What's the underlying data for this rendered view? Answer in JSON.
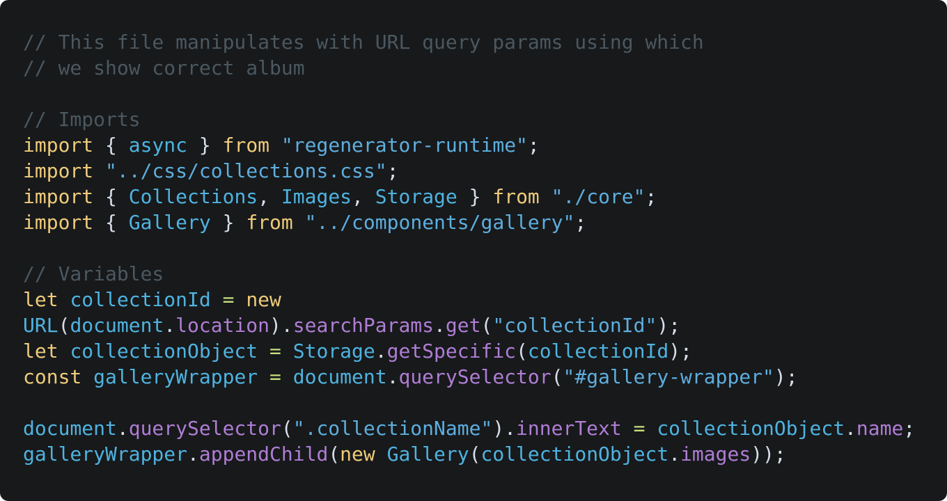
{
  "editor": {
    "background": "#17191b",
    "colors": {
      "comment": "#4b5860",
      "keyword": "#efcb7a",
      "identifier": "#4fb3e0",
      "string": "#5eaede",
      "property": "#b07dd4",
      "punctuation": "#d8dee9",
      "operator": "#c8df7c"
    },
    "lines": [
      [
        {
          "t": "comment",
          "v": "// This file manipulates with URL query params using which"
        }
      ],
      [
        {
          "t": "comment",
          "v": "// we show correct album"
        }
      ],
      [],
      [
        {
          "t": "comment",
          "v": "// Imports"
        }
      ],
      [
        {
          "t": "keyword",
          "v": "import"
        },
        {
          "t": "punct",
          "v": " { "
        },
        {
          "t": "ident",
          "v": "async"
        },
        {
          "t": "punct",
          "v": " } "
        },
        {
          "t": "keyword",
          "v": "from"
        },
        {
          "t": "punct",
          "v": " "
        },
        {
          "t": "string",
          "v": "\"regenerator-runtime\""
        },
        {
          "t": "punct",
          "v": ";"
        }
      ],
      [
        {
          "t": "keyword",
          "v": "import"
        },
        {
          "t": "punct",
          "v": " "
        },
        {
          "t": "string",
          "v": "\"../css/collections.css\""
        },
        {
          "t": "punct",
          "v": ";"
        }
      ],
      [
        {
          "t": "keyword",
          "v": "import"
        },
        {
          "t": "punct",
          "v": " { "
        },
        {
          "t": "ident",
          "v": "Collections"
        },
        {
          "t": "punct",
          "v": ", "
        },
        {
          "t": "ident",
          "v": "Images"
        },
        {
          "t": "punct",
          "v": ", "
        },
        {
          "t": "ident",
          "v": "Storage"
        },
        {
          "t": "punct",
          "v": " } "
        },
        {
          "t": "keyword",
          "v": "from"
        },
        {
          "t": "punct",
          "v": " "
        },
        {
          "t": "string",
          "v": "\"./core\""
        },
        {
          "t": "punct",
          "v": ";"
        }
      ],
      [
        {
          "t": "keyword",
          "v": "import"
        },
        {
          "t": "punct",
          "v": " { "
        },
        {
          "t": "ident",
          "v": "Gallery"
        },
        {
          "t": "punct",
          "v": " } "
        },
        {
          "t": "keyword",
          "v": "from"
        },
        {
          "t": "punct",
          "v": " "
        },
        {
          "t": "string",
          "v": "\"../components/gallery\""
        },
        {
          "t": "punct",
          "v": ";"
        }
      ],
      [],
      [
        {
          "t": "comment",
          "v": "// Variables"
        }
      ],
      [
        {
          "t": "keyword",
          "v": "let"
        },
        {
          "t": "punct",
          "v": " "
        },
        {
          "t": "ident",
          "v": "collectionId"
        },
        {
          "t": "punct",
          "v": " "
        },
        {
          "t": "op",
          "v": "="
        },
        {
          "t": "punct",
          "v": " "
        },
        {
          "t": "keyword",
          "v": "new"
        }
      ],
      [
        {
          "t": "ident",
          "v": "URL"
        },
        {
          "t": "punct",
          "v": "("
        },
        {
          "t": "ident",
          "v": "document"
        },
        {
          "t": "punct",
          "v": "."
        },
        {
          "t": "prop",
          "v": "location"
        },
        {
          "t": "punct",
          "v": ")."
        },
        {
          "t": "prop",
          "v": "searchParams"
        },
        {
          "t": "punct",
          "v": "."
        },
        {
          "t": "prop",
          "v": "get"
        },
        {
          "t": "punct",
          "v": "("
        },
        {
          "t": "string",
          "v": "\"collectionId\""
        },
        {
          "t": "punct",
          "v": ");"
        }
      ],
      [
        {
          "t": "keyword",
          "v": "let"
        },
        {
          "t": "punct",
          "v": " "
        },
        {
          "t": "ident",
          "v": "collectionObject"
        },
        {
          "t": "punct",
          "v": " "
        },
        {
          "t": "op",
          "v": "="
        },
        {
          "t": "punct",
          "v": " "
        },
        {
          "t": "ident",
          "v": "Storage"
        },
        {
          "t": "punct",
          "v": "."
        },
        {
          "t": "prop",
          "v": "getSpecific"
        },
        {
          "t": "punct",
          "v": "("
        },
        {
          "t": "ident",
          "v": "collectionId"
        },
        {
          "t": "punct",
          "v": ");"
        }
      ],
      [
        {
          "t": "keyword",
          "v": "const"
        },
        {
          "t": "punct",
          "v": " "
        },
        {
          "t": "ident",
          "v": "galleryWrapper"
        },
        {
          "t": "punct",
          "v": " "
        },
        {
          "t": "op",
          "v": "="
        },
        {
          "t": "punct",
          "v": " "
        },
        {
          "t": "ident",
          "v": "document"
        },
        {
          "t": "punct",
          "v": "."
        },
        {
          "t": "prop",
          "v": "querySelector"
        },
        {
          "t": "punct",
          "v": "("
        },
        {
          "t": "string",
          "v": "\"#gallery-wrapper\""
        },
        {
          "t": "punct",
          "v": ");"
        }
      ],
      [],
      [
        {
          "t": "ident",
          "v": "document"
        },
        {
          "t": "punct",
          "v": "."
        },
        {
          "t": "prop",
          "v": "querySelector"
        },
        {
          "t": "punct",
          "v": "("
        },
        {
          "t": "string",
          "v": "\".collectionName\""
        },
        {
          "t": "punct",
          "v": ")."
        },
        {
          "t": "prop",
          "v": "innerText"
        },
        {
          "t": "punct",
          "v": " "
        },
        {
          "t": "op",
          "v": "="
        },
        {
          "t": "punct",
          "v": " "
        },
        {
          "t": "ident",
          "v": "collectionObject"
        },
        {
          "t": "punct",
          "v": "."
        },
        {
          "t": "prop",
          "v": "name"
        },
        {
          "t": "punct",
          "v": ";"
        }
      ],
      [
        {
          "t": "ident",
          "v": "galleryWrapper"
        },
        {
          "t": "punct",
          "v": "."
        },
        {
          "t": "prop",
          "v": "appendChild"
        },
        {
          "t": "punct",
          "v": "("
        },
        {
          "t": "keyword",
          "v": "new"
        },
        {
          "t": "punct",
          "v": " "
        },
        {
          "t": "ident",
          "v": "Gallery"
        },
        {
          "t": "punct",
          "v": "("
        },
        {
          "t": "ident",
          "v": "collectionObject"
        },
        {
          "t": "punct",
          "v": "."
        },
        {
          "t": "prop",
          "v": "images"
        },
        {
          "t": "punct",
          "v": "));"
        }
      ]
    ]
  }
}
